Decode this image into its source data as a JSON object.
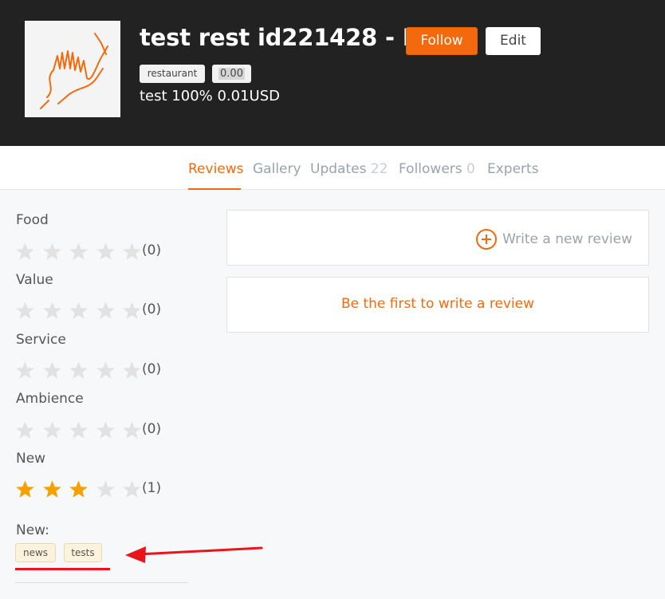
{
  "header": {
    "title": "test rest id221428 - Di",
    "follow_label": "Follow",
    "edit_label": "Edit",
    "category_tag": "restaurant",
    "score": "0.00",
    "subline": "test 100% 0.01USD"
  },
  "tabs": [
    {
      "label": "Reviews",
      "count": ""
    },
    {
      "label": "Gallery",
      "count": ""
    },
    {
      "label": "Updates",
      "count": "22"
    },
    {
      "label": "Followers",
      "count": "0"
    },
    {
      "label": "Experts",
      "count": ""
    }
  ],
  "ratings": [
    {
      "label": "Food",
      "stars": 0,
      "count": "(0)"
    },
    {
      "label": "Value",
      "stars": 0,
      "count": "(0)"
    },
    {
      "label": "Service",
      "stars": 0,
      "count": "(0)"
    },
    {
      "label": "Ambience",
      "stars": 0,
      "count": "(0)"
    },
    {
      "label": "New",
      "stars": 3,
      "count": "(1)"
    }
  ],
  "tags_section": {
    "label": "New:",
    "chips": [
      "news",
      "tests"
    ]
  },
  "reviews": {
    "write_label": "Write a new review",
    "empty_label": "Be the first to write a review"
  },
  "colors": {
    "accent": "#f26a0d",
    "star_filled": "#f5a000",
    "star_empty": "#e2e2e2",
    "annotation": "#e8161a"
  },
  "icons": {
    "logo": "hand-logo",
    "plus": "plus-circle-icon",
    "star": "star-icon",
    "arrow": "red-arrow-annotation"
  }
}
